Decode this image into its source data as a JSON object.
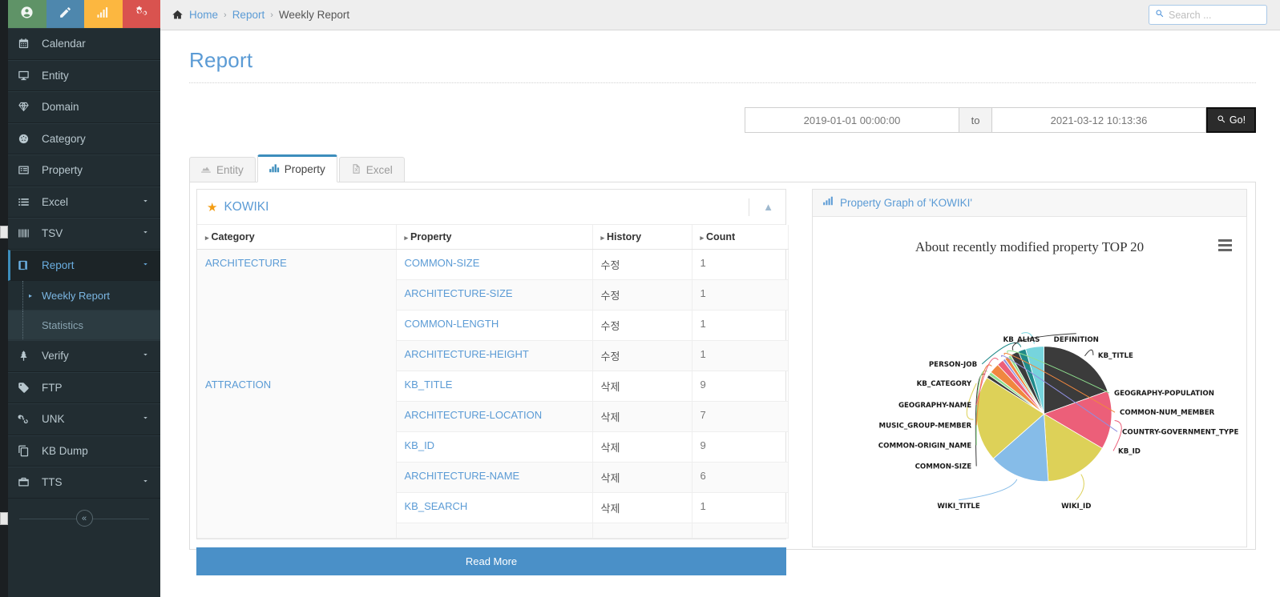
{
  "sidebar": {
    "brand_icons": [
      {
        "name": "user-icon",
        "color": "#5f9367"
      },
      {
        "name": "pencil-icon",
        "color": "#4e87ad"
      },
      {
        "name": "bar-chart-icon",
        "color": "#fcb740"
      },
      {
        "name": "gears-icon",
        "color": "#d9534f"
      }
    ],
    "items": [
      {
        "label": "Calendar",
        "icon": "calendar-icon",
        "caret": false
      },
      {
        "label": "Entity",
        "icon": "desktop-icon",
        "caret": false
      },
      {
        "label": "Domain",
        "icon": "diamond-icon",
        "caret": false
      },
      {
        "label": "Category",
        "icon": "dashboard-icon",
        "caret": false
      },
      {
        "label": "Property",
        "icon": "list-alt-icon",
        "caret": false
      },
      {
        "label": "Excel",
        "icon": "list-icon",
        "caret": true
      },
      {
        "label": "TSV",
        "icon": "barcode-icon",
        "caret": true
      },
      {
        "label": "Report",
        "icon": "book-icon",
        "caret": true,
        "active": true
      },
      {
        "label": "Verify",
        "icon": "tree-icon",
        "caret": true
      },
      {
        "label": "FTP",
        "icon": "tag-icon",
        "caret": false
      },
      {
        "label": "UNK",
        "icon": "link-icon",
        "caret": true
      },
      {
        "label": "KB Dump",
        "icon": "copy-icon",
        "caret": false
      },
      {
        "label": "TTS",
        "icon": "briefcase-icon",
        "caret": true
      }
    ],
    "report_submenu": [
      {
        "label": "Weekly Report",
        "selected": true
      },
      {
        "label": "Statistics",
        "selected": false
      }
    ],
    "collapse_label": "«"
  },
  "topbar": {
    "breadcrumb": [
      {
        "label": "Home",
        "link": true
      },
      {
        "label": "Report",
        "link": true
      },
      {
        "label": "Weekly Report",
        "link": false
      }
    ],
    "separator": "›",
    "search_placeholder": "Search ...",
    "search_value": ""
  },
  "page": {
    "title": "Report"
  },
  "daterange": {
    "from": "2019-01-01 00:00:00",
    "to_label": "to",
    "until": "2021-03-12 10:13:36",
    "go_label": "Go!"
  },
  "tabs": [
    {
      "label": "Entity",
      "icon": "area-chart-icon",
      "active": false
    },
    {
      "label": "Property",
      "icon": "bar-chart-icon",
      "active": true
    },
    {
      "label": "Excel",
      "icon": "file-excel-icon",
      "active": false
    }
  ],
  "kowiki_panel": {
    "title": "KOWIKI",
    "star_icon": "star-icon",
    "collapse_icon": "chevron-up-icon",
    "columns": [
      "Category",
      "Property",
      "History",
      "Count"
    ],
    "rows": [
      {
        "category": "ARCHITECTURE",
        "rowspan": 4,
        "items": [
          {
            "property": "COMMON-SIZE",
            "history": "수정",
            "count": "1"
          },
          {
            "property": "ARCHITECTURE-SIZE",
            "history": "수정",
            "count": "1"
          },
          {
            "property": "COMMON-LENGTH",
            "history": "수정",
            "count": "1"
          },
          {
            "property": "ARCHITECTURE-HEIGHT",
            "history": "수정",
            "count": "1"
          }
        ]
      },
      {
        "category": "ATTRACTION",
        "rowspan": 5,
        "items": [
          {
            "property": "KB_TITLE",
            "history": "삭제",
            "count": "9"
          },
          {
            "property": "ARCHITECTURE-LOCATION",
            "history": "삭제",
            "count": "7"
          },
          {
            "property": "KB_ID",
            "history": "삭제",
            "count": "9"
          },
          {
            "property": "ARCHITECTURE-NAME",
            "history": "삭제",
            "count": "6"
          },
          {
            "property": "KB_SEARCH",
            "history": "삭제",
            "count": "1"
          }
        ]
      }
    ],
    "read_more_label": "Read More"
  },
  "chart_panel": {
    "header": "Property Graph of 'KOWIKI'",
    "header_icon": "bar-chart-icon",
    "menu_icon": "hamburger-menu-icon"
  },
  "chart_data": {
    "type": "pie",
    "title": "About recently modified property TOP 20",
    "xlabel": "",
    "ylabel": "",
    "legend_position": "labels-outside",
    "grid": false,
    "categories": [
      "KB_TITLE",
      "KB_ID",
      "WIKI_ID",
      "WIKI_TITLE",
      "KB_CATEGORY",
      "COMMON-SIZE",
      "COMMON-ORIGIN_NAME",
      "MUSIC_GROUP-MEMBER",
      "GEOGRAPHY-NAME",
      "COUNTRY-GOVERNMENT_TYPE",
      "COMMON-NUM_MEMBER",
      "GEOGRAPHY-POPULATION",
      "DEFINITION",
      "PERSON-JOB",
      "KB_ALIAS"
    ],
    "values": [
      19.5,
      14.0,
      15.5,
      14.5,
      20.5,
      0.8,
      0.8,
      2.4,
      1.6,
      0.6,
      0.9,
      0.7,
      2.0,
      1.8,
      4.4
    ],
    "colors": [
      "#3b3b3b",
      "#ec5f79",
      "#ddd158",
      "#86bce8",
      "#ddd158",
      "#3b3b3b",
      "#8fe08f",
      "#f0873f",
      "#ec5f79",
      "#8f8fe0",
      "#f0873f",
      "#8fe08f",
      "#3b3b3b",
      "#1f8a8a",
      "#76d4dd"
    ]
  }
}
